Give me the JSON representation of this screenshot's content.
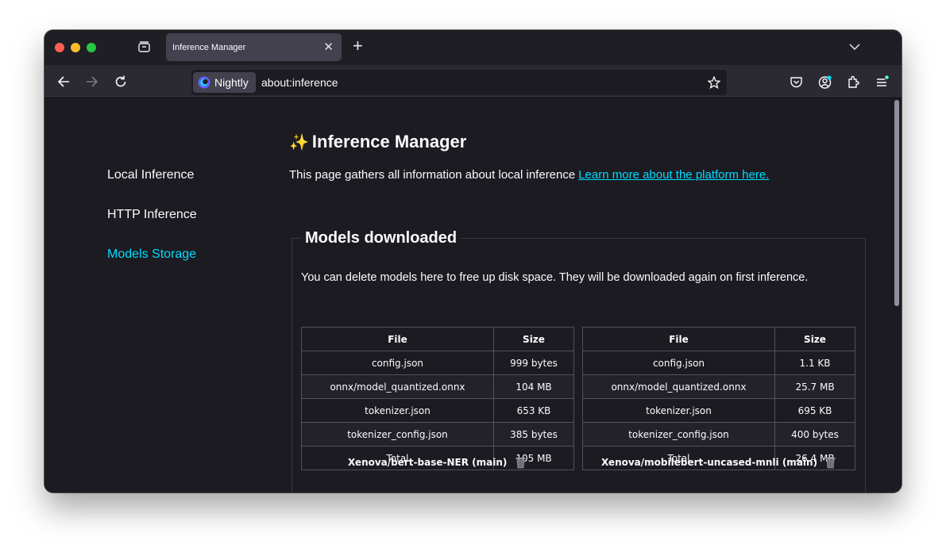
{
  "browser": {
    "tab_title": "Inference Manager",
    "tab_close": "✕",
    "new_tab": "+",
    "identity_label": "Nightly",
    "url": "about:inference"
  },
  "sidebar": {
    "items": [
      {
        "label": "Local Inference"
      },
      {
        "label": "HTTP Inference"
      },
      {
        "label": "Models Storage"
      }
    ]
  },
  "page": {
    "title_emoji": "✨",
    "title": "Inference Manager",
    "intro_text": "This page gathers all information about local inference",
    "intro_link": "Learn more about the platform here."
  },
  "models_section": {
    "heading": "Models downloaded",
    "description": "You can delete models here to free up disk space. They will be downloaded again on first inference.",
    "header_file": "File",
    "header_size": "Size",
    "models": [
      {
        "name": "Xenova/bert-base-NER (main)",
        "rows": [
          {
            "file": "config.json",
            "size": "999 bytes"
          },
          {
            "file": "onnx/model_quantized.onnx",
            "size": "104 MB"
          },
          {
            "file": "tokenizer.json",
            "size": "653 KB"
          },
          {
            "file": "tokenizer_config.json",
            "size": "385 bytes"
          },
          {
            "file": "Total",
            "size": "105 MB"
          }
        ]
      },
      {
        "name": "Xenova/mobilebert-uncased-mnli (main)",
        "rows": [
          {
            "file": "config.json",
            "size": "1.1 KB"
          },
          {
            "file": "onnx/model_quantized.onnx",
            "size": "25.7 MB"
          },
          {
            "file": "tokenizer.json",
            "size": "695 KB"
          },
          {
            "file": "tokenizer_config.json",
            "size": "400 bytes"
          },
          {
            "file": "Total",
            "size": "26.4 MB"
          }
        ]
      }
    ]
  },
  "colors": {
    "accent": "#00ddff",
    "background": "#1c1b22",
    "text": "#fbfbfe"
  }
}
